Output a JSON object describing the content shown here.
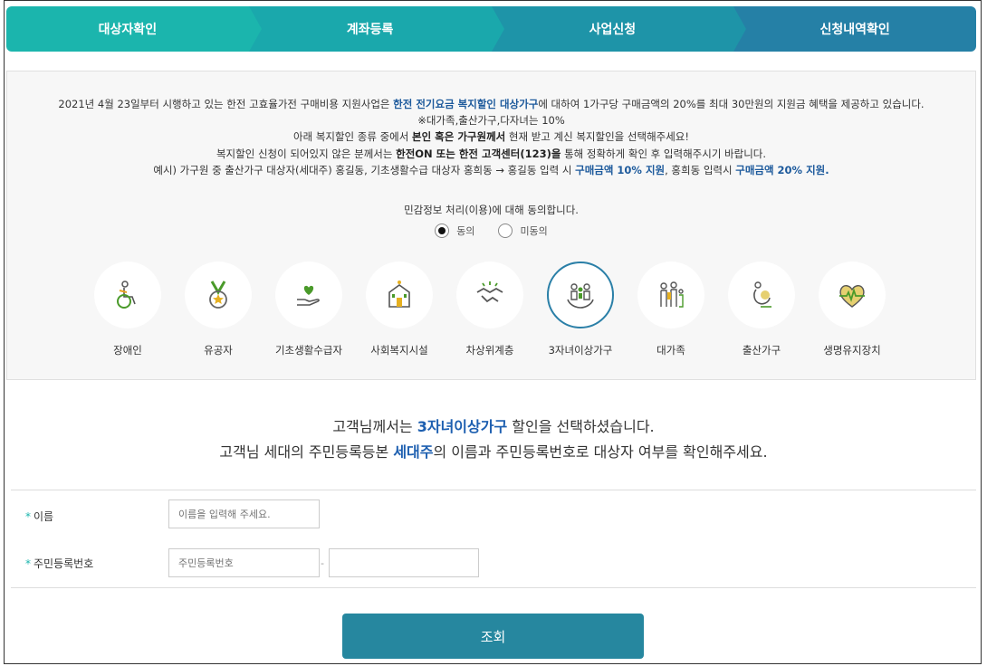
{
  "steps": [
    "대상자확인",
    "계좌등록",
    "사업신청",
    "신청내역확인"
  ],
  "info": {
    "line1_a": "2021년 4월 23일부터 시행하고 있는 한전 고효율가전 구매비용 지원사업은 ",
    "line1_b": "한전 전기요금 복지할인 대상가구",
    "line1_c": "에 대하여 1가구당 구매금액의 20%를 최대 30만원의 지원금 혜택을 제공하고 있습니다.",
    "line2": "※대가족,출산가구,다자녀는 10%",
    "line3_a": "아래 복지할인 종류 중에서 ",
    "line3_b": "본인 혹은 가구원께서",
    "line3_c": " 현재 받고 계신 복지할인을 선택해주세요!",
    "line4_a": "복지할인 신청이 되어있지 않은 분께서는 ",
    "line4_b": "한전ON 또는 한전 고객센터(123)을",
    "line4_c": " 통해 정확하게 확인 후 입력해주시기 바랍니다.",
    "line5_a": "예시) 가구원 중 출산가구 대상자(세대주) 홍길동, 기초생활수급 대상자 홍희동 → 홍길동 입력 시 ",
    "line5_b": "구매금액 10% 지원",
    "line5_c": ", 홍희동 입력시 ",
    "line5_d": "구매금액 20% 지원."
  },
  "consent": {
    "question": "민감정보 처리(이용)에 대해 동의합니다.",
    "agree": "동의",
    "disagree": "미동의",
    "selected": "agree"
  },
  "categories": [
    {
      "label": "장애인",
      "icon": "wheelchair-icon"
    },
    {
      "label": "유공자",
      "icon": "medal-icon"
    },
    {
      "label": "기초생활수급자",
      "icon": "heart-hand-icon"
    },
    {
      "label": "사회복지시설",
      "icon": "building-icon"
    },
    {
      "label": "차상위계층",
      "icon": "handshake-icon"
    },
    {
      "label": "3자녀이상가구",
      "icon": "family-hands-icon"
    },
    {
      "label": "대가족",
      "icon": "big-family-icon"
    },
    {
      "label": "출산가구",
      "icon": "mother-baby-icon"
    },
    {
      "label": "생명유지장치",
      "icon": "heartbeat-icon"
    }
  ],
  "selected_category": "3자녀이상가구",
  "message": {
    "line1_a": "고객님께서는 ",
    "line1_b": "3자녀이상가구",
    "line1_c": " 할인을 선택하셨습니다.",
    "line2_a": "고객님 세대의 주민등록등본 ",
    "line2_b": "세대주",
    "line2_c": "의 이름과 주민등록번호로 대상자 여부를 확인해주세요."
  },
  "form": {
    "name_label": "이름",
    "name_placeholder": "이름을 입력해 주세요.",
    "rrn_label": "주민등록번호",
    "rrn_placeholder": "주민등록번호",
    "rrn_separator": "-",
    "required_mark": "*"
  },
  "submit_label": "조회",
  "colors": {
    "accent": "#1bb5ad",
    "button": "#26879f",
    "highlight": "#1d5fb0"
  }
}
